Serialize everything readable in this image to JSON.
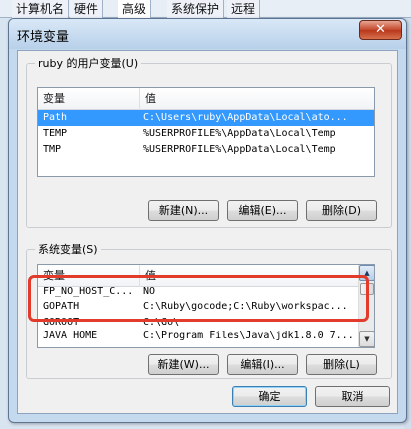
{
  "background_tabs": [
    "计算机名",
    "硬件",
    "高级",
    "系统保护",
    "远程"
  ],
  "dialog": {
    "title": "环境变量",
    "title_ghost": "…",
    "close_symbol": "✕"
  },
  "user_vars": {
    "group_title": "ruby 的用户变量(U)",
    "columns": [
      "变量",
      "值"
    ],
    "rows": [
      {
        "name": "Path",
        "value": "C:\\Users\\ruby\\AppData\\Local\\ato...",
        "selected": true
      },
      {
        "name": "TEMP",
        "value": "%USERPROFILE%\\AppData\\Local\\Temp",
        "selected": false
      },
      {
        "name": "TMP",
        "value": "%USERPROFILE%\\AppData\\Local\\Temp",
        "selected": false
      }
    ],
    "buttons": {
      "new": "新建(N)...",
      "edit": "编辑(E)...",
      "delete": "删除(D)"
    }
  },
  "system_vars": {
    "group_title": "系统变量(S)",
    "columns": [
      "变量",
      "值"
    ],
    "rows": [
      {
        "name": "FP_NO_HOST_C...",
        "value": "NO"
      },
      {
        "name": "GOPATH",
        "value": "C:\\Ruby\\gocode;C:\\Ruby\\workspac..."
      },
      {
        "name": "GOROOT",
        "value": "C:\\Go\\"
      },
      {
        "name": "JAVA_HOME",
        "value": "C:\\Program Files\\Java\\jdk1.8.0_7..."
      }
    ],
    "buttons": {
      "new": "新建(W)...",
      "edit": "编辑(I)...",
      "delete": "删除(L)"
    }
  },
  "footer": {
    "ok": "确定",
    "cancel": "取消"
  },
  "colors": {
    "selection": "#3399ff",
    "highlight_box": "#e23b2b"
  }
}
